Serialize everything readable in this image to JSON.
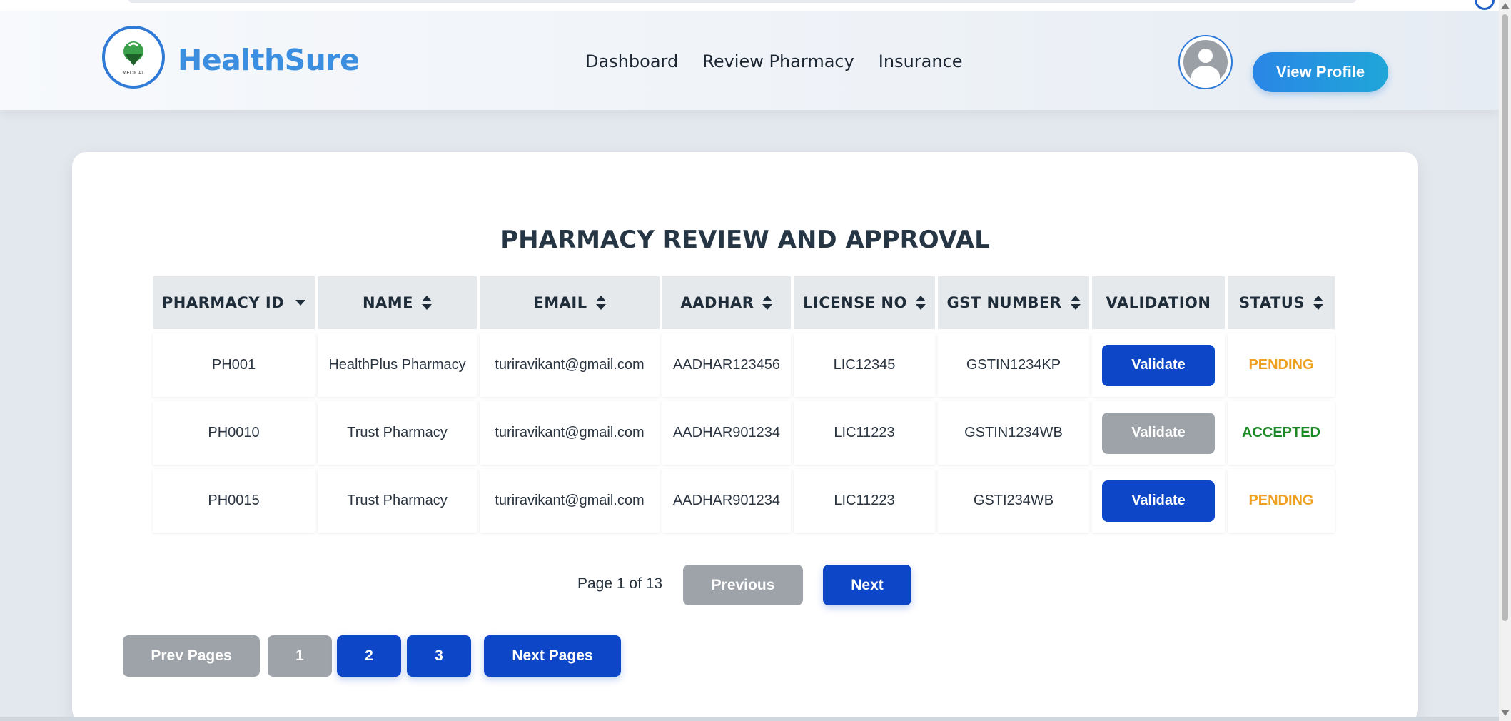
{
  "header": {
    "brand": "HealthSure",
    "nav": [
      "Dashboard",
      "Review Pharmacy",
      "Insurance"
    ],
    "view_profile": "View Profile",
    "logo_text": "MEDICAL"
  },
  "page_title": "PHARMACY REVIEW AND APPROVAL",
  "table": {
    "columns": [
      "PHARMACY ID",
      "NAME",
      "EMAIL",
      "AADHAR",
      "LICENSE NO",
      "GST NUMBER",
      "VALIDATION",
      "STATUS"
    ],
    "rows": [
      {
        "id": "PH001",
        "name": "HealthPlus Pharmacy",
        "email": "turiravikant@gmail.com",
        "aadhar": "AADHAR123456",
        "license": "LIC12345",
        "gst": "GSTIN1234KP",
        "validate": "Validate",
        "status": "PENDING"
      },
      {
        "id": "PH0010",
        "name": "Trust Pharmacy",
        "email": "turiravikant@gmail.com",
        "aadhar": "AADHAR901234",
        "license": "LIC11223",
        "gst": "GSTIN1234WB",
        "validate": "Validate",
        "status": "ACCEPTED"
      },
      {
        "id": "PH0015",
        "name": "Trust Pharmacy",
        "email": "turiravikant@gmail.com",
        "aadhar": "AADHAR901234",
        "license": "LIC11223",
        "gst": "GSTI234WB",
        "validate": "Validate",
        "status": "PENDING"
      }
    ]
  },
  "pagination": {
    "page_info": "Page 1 of 13",
    "previous": "Previous",
    "next": "Next",
    "prev_pages": "Prev Pages",
    "pages": [
      "1",
      "2",
      "3"
    ],
    "next_pages": "Next Pages"
  },
  "colors": {
    "primary": "#0d47c8",
    "disabled": "#9ea3aa",
    "pending": "#f0a020",
    "accepted": "#1b8a25",
    "brand": "#3b8ee0"
  }
}
